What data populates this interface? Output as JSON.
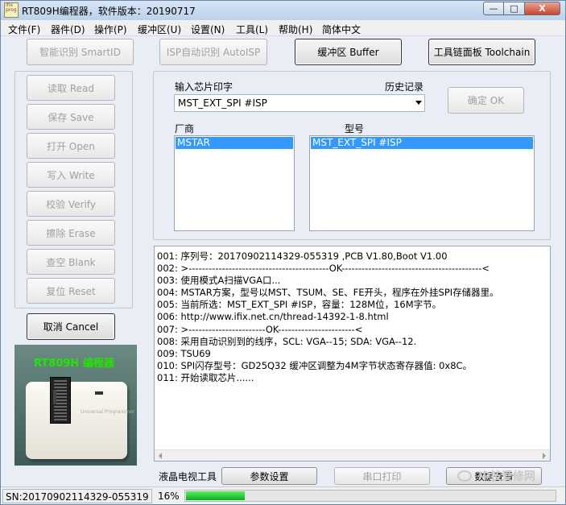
{
  "window": {
    "title": "RT809H编程器，软件版本：20190717",
    "app_icon_text": "ifix prog",
    "minimize": "—",
    "maximize": "□",
    "close": "X"
  },
  "menu": [
    "文件(F)",
    "器件(D)",
    "操作(P)",
    "缓冲区(U)",
    "设置(N)",
    "工具(L)",
    "帮助(H)",
    "简体中文"
  ],
  "top_buttons": {
    "smart_id": "智能识别 SmartID",
    "isp_auto": "ISP自动识别 AutoISP",
    "buffer": "缓冲区 Buffer",
    "toolchain": "工具链面板 Toolchain"
  },
  "ops": {
    "read": "读取 Read",
    "save": "保存 Save",
    "open": "打开 Open",
    "write": "写入 Write",
    "verify": "校验 Verify",
    "erase": "擦除 Erase",
    "blank": "查空 Blank",
    "reset": "复位 Reset",
    "cancel": "取消 Cancel"
  },
  "chip_select": {
    "input_label": "输入芯片印字",
    "history_label": "历史记录",
    "value": "MST_EXT_SPI #ISP",
    "ok": "确定 OK",
    "vendor_label": "厂商",
    "model_label": "型号",
    "vendors": [
      "MSTAR"
    ],
    "models": [
      "MST_EXT_SPI #ISP"
    ]
  },
  "log": [
    "001: 序列号：20170902114329-055319  ,PCB V1.80,Boot V1.00",
    "002: >------------------------------------------OK------------------------------------------<",
    "003: 使用模式A扫描VGA口...",
    "004: MSTAR方案，型号以MST、TSUM、SE、FE开头，程序在外挂SPI存储器里。",
    "005: 当前所选：MST_EXT_SPI #ISP，容量：128M位，16M字节。",
    "006: http://www.ifix.net.cn/thread-14392-1-8.html",
    "007: >-----------------------OK-----------------------<",
    "008: 采用自动识别到的线序，SCL: VGA--15; SDA: VGA--12.",
    "009: TSU69",
    "010: SPI闪存型号：GD25Q32 缓冲区调整为4M字节状态寄存器值: 0x8C。",
    "011: 开始读取芯片......"
  ],
  "bottom_tools": {
    "lcd_tv_label": "液晶电视工具",
    "params": "参数设置",
    "serial_print": "串口打印",
    "data_compare": "数据查看"
  },
  "device_caption": "RT809H 编程器",
  "device_logo": "Universal Programmer",
  "status": {
    "sn": "SN:20170902114329-055319",
    "percent_text": "16%",
    "progress": 0.16
  },
  "watermark": "中技爱修网"
}
